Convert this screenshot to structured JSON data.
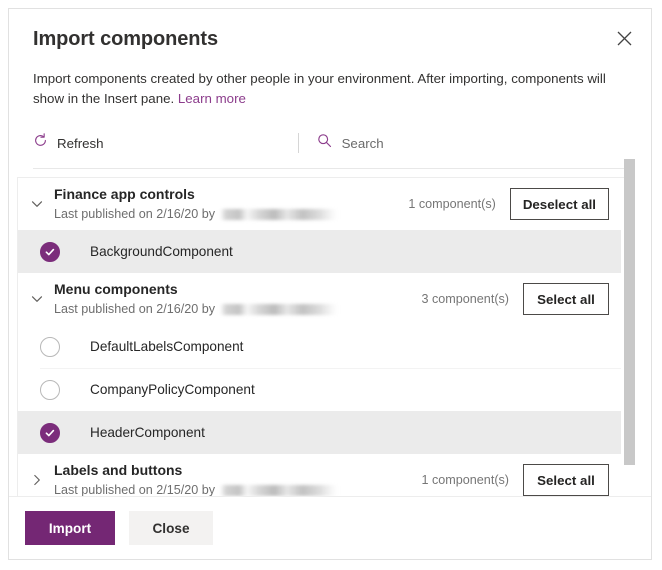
{
  "dialog": {
    "title": "Import components",
    "close_icon": "close-icon",
    "description_prefix": "Import components created by other people in your environment. After importing, components will show in the Insert pane.",
    "learn_more": "Learn more"
  },
  "command_bar": {
    "refresh_icon": "refresh-icon",
    "refresh_label": "Refresh",
    "search_icon": "search-icon",
    "search_placeholder": "Search"
  },
  "groups": [
    {
      "title": "Finance app controls",
      "subtitle": "Last published on 2/16/20 by",
      "author_redacted": true,
      "count_label": "1 component(s)",
      "action_label": "Deselect all",
      "expanded": true,
      "chevron_icon": "chevron-down-icon",
      "components": [
        {
          "name": "BackgroundComponent",
          "selected": true
        }
      ]
    },
    {
      "title": "Menu components",
      "subtitle": "Last published on 2/16/20 by",
      "author_redacted": true,
      "count_label": "3 component(s)",
      "action_label": "Select all",
      "expanded": true,
      "chevron_icon": "chevron-down-icon",
      "components": [
        {
          "name": "DefaultLabelsComponent",
          "selected": false
        },
        {
          "name": "CompanyPolicyComponent",
          "selected": false
        },
        {
          "name": "HeaderComponent",
          "selected": true
        }
      ]
    },
    {
      "title": "Labels and buttons",
      "subtitle": "Last published on 2/15/20 by",
      "author_redacted": true,
      "count_label": "1 component(s)",
      "action_label": "Select all",
      "expanded": false,
      "chevron_icon": "chevron-right-icon",
      "components": []
    }
  ],
  "footer": {
    "import_label": "Import",
    "close_label": "Close"
  },
  "colors": {
    "accent_purple": "#742774",
    "check_purple": "#7b2d7b",
    "link_purple": "#8c3d8c",
    "selected_row": "#ebebeb",
    "scrollbar_thumb": "#c8c8c8"
  }
}
